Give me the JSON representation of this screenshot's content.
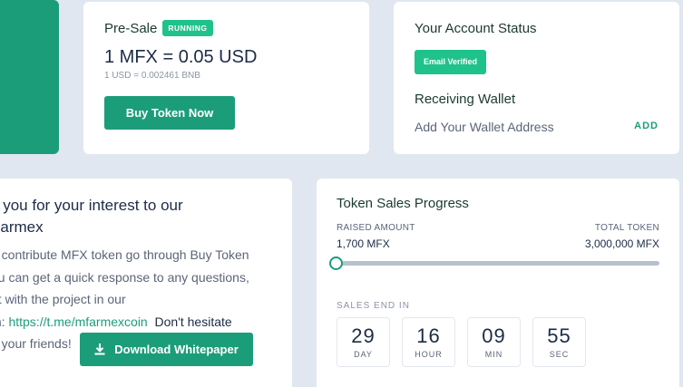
{
  "colors": {
    "accent": "#1c9d7a",
    "badge": "#1fc28b",
    "background": "#e1e7f0"
  },
  "presale": {
    "title": "Pre-Sale",
    "status_badge": "RUNNING",
    "price": "1 MFX = 0.05 USD",
    "conversion": "1 USD = 0.002461 BNB",
    "buy_button": "Buy Token Now"
  },
  "account": {
    "title": "Your Account Status",
    "email_badge": "Email Verified",
    "wallet_title": "Receiving Wallet",
    "wallet_prompt": "Add Your Wallet Address",
    "wallet_add": "ADD"
  },
  "thanks": {
    "heading_line1": "k you for your interest to our",
    "heading_line2": "Farmex",
    "body_line1": "n contribute MFX token go through Buy Token",
    "body_line2": "ou can get a quick response to any questions,",
    "body_line3": "at with the project in our",
    "body_line4_prefix": "m: ",
    "body_link": "https://t.me/mfarmexcoin",
    "body_line4_suffix": "Don't hesitate",
    "body_line5": "e your friends!",
    "download_button": "Download Whitepaper",
    "download_icon": "download-icon"
  },
  "progress": {
    "title": "Token Sales Progress",
    "raised_label": "RAISED AMOUNT",
    "raised_value": "1,700 MFX",
    "total_label": "TOTAL TOKEN",
    "total_value": "3,000,000 MFX",
    "progress_fraction": 0.0006,
    "sales_end_label": "SALES END IN",
    "countdown": [
      {
        "value": "29",
        "unit": "DAY"
      },
      {
        "value": "16",
        "unit": "HOUR"
      },
      {
        "value": "09",
        "unit": "MIN"
      },
      {
        "value": "55",
        "unit": "SEC"
      }
    ]
  }
}
